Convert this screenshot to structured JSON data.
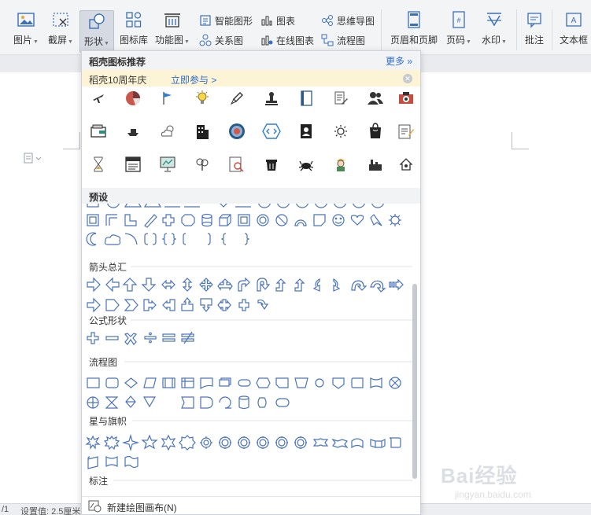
{
  "ribbon": {
    "picture": "图片",
    "screenshot": "截屏",
    "shape": "形状",
    "icon_library": "图标库",
    "function_chart": "功能图",
    "smart_graphic": "智能图形",
    "relation_chart": "关系图",
    "chart": "图表",
    "online_chart": "在线图表",
    "mind_map": "思维导图",
    "flowchart": "流程图",
    "header_footer": "页眉和页脚",
    "page_number": "页码",
    "watermark": "水印",
    "comment": "批注",
    "textbox": "文本框"
  },
  "panel": {
    "title": "稻壳图标推荐",
    "more": "更多",
    "banner_text": "稻壳10周年庆",
    "banner_link": "立即参与 >",
    "preset": "预设",
    "sections": {
      "arrows": "箭头总汇",
      "equation": "公式形状",
      "flowchart": "流程图",
      "stars": "星与旗帜",
      "callouts": "标注"
    },
    "footer": "新建绘图画布(N)"
  },
  "statusbar": {
    "page": "/1",
    "setting": "设置值: 2.5厘米"
  },
  "watermark": {
    "top": "Bai经验",
    "bottom": "jingyan.baidu.com"
  },
  "colors": {
    "accent_blue": "#2d6dcc",
    "shape_stroke": "#4a73b8",
    "banner_bg": "#fdf3d5"
  }
}
